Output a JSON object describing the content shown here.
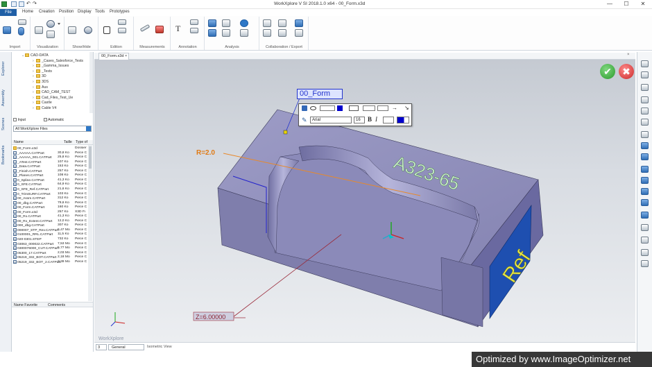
{
  "window": {
    "title": "WorkXplore V SI 2018.1.0 x64 - 00_Form.x3d",
    "minimize": "—",
    "maximize": "☐",
    "close": "✕"
  },
  "menu": {
    "file": "File",
    "items": [
      "Home",
      "Creation",
      "Position",
      "Display",
      "Tools",
      "Prototypes"
    ]
  },
  "ribbon": {
    "groups": [
      "Import",
      "Visualization",
      "Show/Hide",
      "Edition",
      "Measurements",
      "Annotation",
      "Analysis",
      "Collaboration / Export"
    ]
  },
  "left_tabs": [
    "Explorer",
    "Assembly",
    "Scenes",
    "Bookmarks"
  ],
  "explorer": {
    "tree": [
      {
        "label": "CAD-DATA",
        "expanded": true
      },
      {
        "label": "_Cases_Salesforce_Tests"
      },
      {
        "label": "_Gamma_Issues"
      },
      {
        "label": "_Tests"
      },
      {
        "label": "3D"
      },
      {
        "label": "3DS"
      },
      {
        "label": "Aus"
      },
      {
        "label": "CAD_CAM_TEST"
      },
      {
        "label": "Cad_Files_Test_Ue"
      },
      {
        "label": "Castle"
      },
      {
        "label": "Cable V4"
      }
    ],
    "check_input": "Input",
    "check_automatic": "Automatic",
    "filter": "All WorkXplore Files",
    "columns": [
      "Name",
      "Taille",
      "Type of"
    ],
    "files": [
      {
        "name": "00_Form.x3d",
        "size": "",
        "type": "Dossier"
      },
      {
        "name": "_AAAAA.CATPart",
        "size": "30,8 Ko",
        "type": "Pièce C"
      },
      {
        "name": "_AAAAA_001.CATPart",
        "size": "25,8 Ko",
        "type": "Pièce C"
      },
      {
        "name": "_ATest.CATPart",
        "size": "107 Ko",
        "type": "Pièce C"
      },
      {
        "name": "_Data.CATPart",
        "size": "153 Ko",
        "type": "Pièce C"
      },
      {
        "name": "_Finish.CATPart",
        "size": "257 Ko",
        "type": "Pièce C"
      },
      {
        "name": "_Planes.CATPart",
        "size": "108 Ko",
        "type": "Pièce C"
      },
      {
        "name": "0_Spline.CATPart",
        "size": "41,3 Ko",
        "type": "Pièce C"
      },
      {
        "name": "0_SFE.CATPart",
        "size": "64,9 Ko",
        "type": "Pièce C"
      },
      {
        "name": "0_SFE_Ref.CATPart",
        "size": "21,6 Ko",
        "type": "Pièce C"
      },
      {
        "name": "0_TrimSURF.CATPart",
        "size": "103 Ko",
        "type": "Pièce C"
      },
      {
        "name": "00_Assm.CATPart",
        "size": "312 Ko",
        "type": "Pièce C"
      },
      {
        "name": "00_dbg.CATPart",
        "size": "79,6 Ko",
        "type": "Pièce C"
      },
      {
        "name": "00_Form.CATPart",
        "size": "160 Ko",
        "type": "Pièce C"
      },
      {
        "name": "00_Form.x3d",
        "size": "257 Ko",
        "type": "X3D Fi"
      },
      {
        "name": "00_Rx.CATPart",
        "size": "41,3 Ko",
        "type": "Pièce C"
      },
      {
        "name": "00_Rx_Extent.CATPart",
        "size": "12,0 Ko",
        "type": "Pièce C"
      },
      {
        "name": "000_dbg.CATPart",
        "size": "307 Ko",
        "type": "Pièce C"
      },
      {
        "name": "000007_STP_Rev.CATPart",
        "size": "6,47 Mo",
        "type": "Pièce C"
      },
      {
        "name": "0100001_RRL.CATPart",
        "size": "11,5 Ko",
        "type": "Pièce C"
      },
      {
        "name": "020-0301.STEP",
        "size": "732 Ko",
        "type": "Pièce C"
      },
      {
        "name": "03063_000022.CATPart",
        "size": "7,53 Mo",
        "type": "Pièce C"
      },
      {
        "name": "0300076000_CUT.CATPart",
        "size": "5,77 Mo",
        "type": "Pièce C"
      },
      {
        "name": "05300_17.CATPart",
        "size": "2,03 Mo",
        "type": "Pièce C"
      },
      {
        "name": "05219_332_BOT.CATPart",
        "size": "2,18 Mo",
        "type": "Pièce C"
      },
      {
        "name": "05219_332_BOT_2.CATPart",
        "size": "2,39 Mo",
        "type": "Pièce C"
      }
    ],
    "bottom_cols": [
      "Name Favorite",
      "Comments"
    ]
  },
  "document_tab": "00_Form.x3d",
  "viewport": {
    "label_form": "00_Form",
    "label_radius": "R=2.0",
    "label_z": "Z=6.00000",
    "engraved_text": "A323-65",
    "ref_text": "Ref",
    "watermark": "WorkXplore",
    "font_name": "Arial",
    "font_size": "16"
  },
  "status": {
    "field1": "3",
    "field2": "General",
    "view": "Isometric View"
  },
  "optimizer_text": "Optimized by www.ImageOptimizer.net",
  "colors": {
    "part": "#8c8bb7",
    "text": "#c9efc9",
    "ref": "#e6e64a",
    "accent": "#1f5fa6"
  }
}
